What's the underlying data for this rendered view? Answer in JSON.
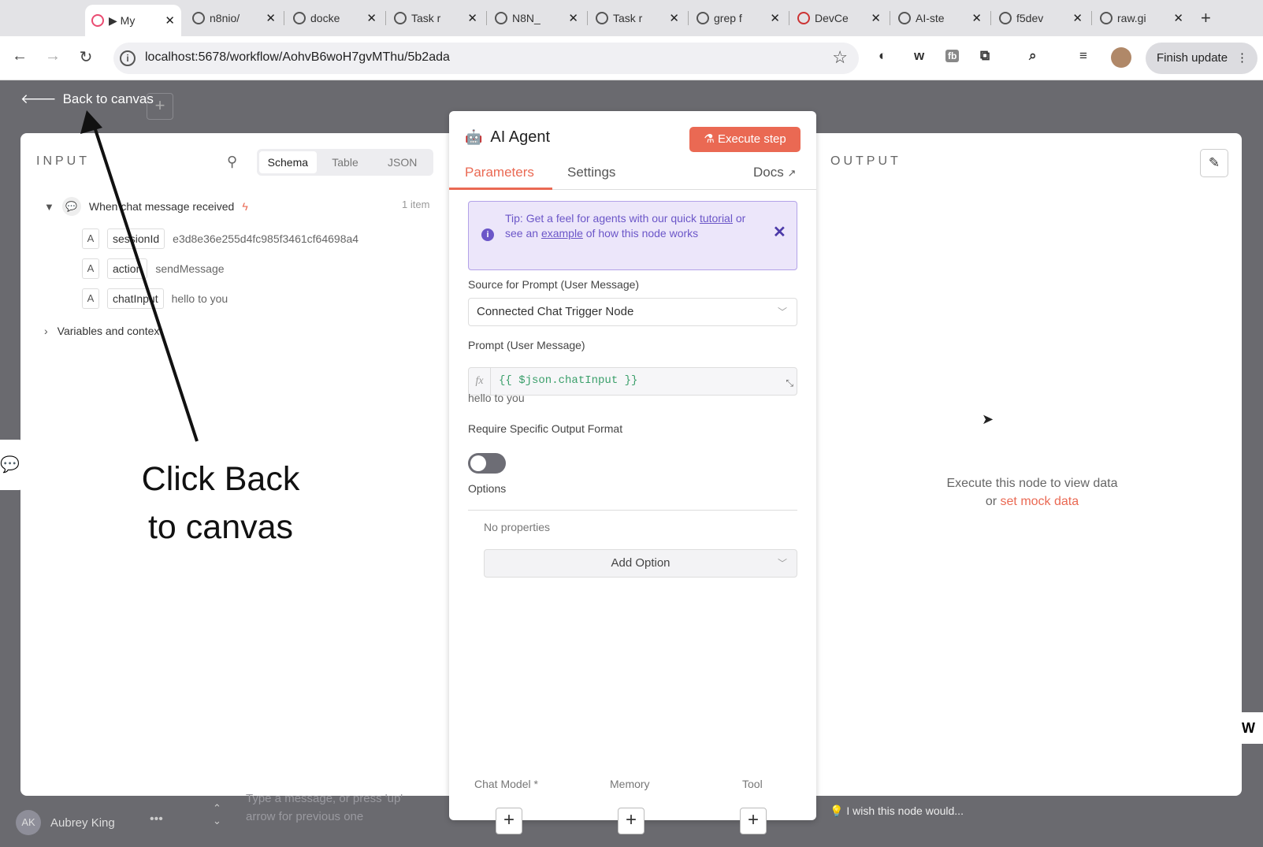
{
  "browser": {
    "tabs": [
      {
        "title": "▶ My"
      },
      {
        "title": "n8nio/"
      },
      {
        "title": "docke"
      },
      {
        "title": "Task r"
      },
      {
        "title": "N8N_"
      },
      {
        "title": "Task r"
      },
      {
        "title": "grep f"
      },
      {
        "title": "DevCe"
      },
      {
        "title": "AI-ste"
      },
      {
        "title": "f5dev"
      },
      {
        "title": "raw.gi"
      }
    ],
    "new_tab": "+",
    "url": "localhost:5678/workflow/AohvB6woH7gvMThu/5b2ada",
    "finish_update": "Finish update",
    "ext_w": "w",
    "ext_fb": "fb"
  },
  "app": {
    "back_to_canvas": "Back to canvas"
  },
  "input": {
    "title": "INPUT",
    "view_tabs": [
      "Schema",
      "Table",
      "JSON"
    ],
    "trigger": "When chat message received",
    "item_count": "1 item",
    "fields": [
      {
        "type": "A",
        "key": "sessionId",
        "value": "e3d8e36e255d4fc985f3461cf64698a4"
      },
      {
        "type": "A",
        "key": "action",
        "value": "sendMessage"
      },
      {
        "type": "A",
        "key": "chatInput",
        "value": "hello to you"
      }
    ],
    "variables": "Variables and context"
  },
  "annotation": {
    "line1": "Click Back",
    "line2": "to canvas"
  },
  "node": {
    "title": "AI Agent",
    "execute_step": "Execute step",
    "tabs": [
      "Parameters",
      "Settings"
    ],
    "docs": "Docs",
    "tip": {
      "prefix": "Tip: Get a feel for agents with our quick ",
      "link1": "tutorial",
      "mid": " or see an ",
      "link2": "example",
      "suffix": " of how this node works"
    },
    "source_label": "Source for Prompt (User Message)",
    "source_value": "Connected Chat Trigger Node",
    "prompt_label": "Prompt (User Message)",
    "prompt_expr": "{{ $json.chatInput }}",
    "prompt_preview": "hello to you",
    "require_label": "Require Specific Output Format",
    "require_on": false,
    "options_label": "Options",
    "no_properties": "No properties",
    "add_option": "Add Option",
    "sub_nodes": [
      "Chat Model *",
      "Memory",
      "Tool"
    ]
  },
  "output": {
    "title": "OUTPUT",
    "message": "Execute this node to view data",
    "or": "or",
    "mock_link": "set mock data"
  },
  "footer": {
    "feedback": "I wish this node would...",
    "user_initials": "AK",
    "user_name": "Aubrey King",
    "chat_placeholder": "Type a message, or press 'up' arrow for previous one"
  },
  "colors": {
    "accent": "#ea6953",
    "tip_bg": "#ece6fa",
    "tip_text": "#6b56c8",
    "expression": "#3a9f6a"
  }
}
